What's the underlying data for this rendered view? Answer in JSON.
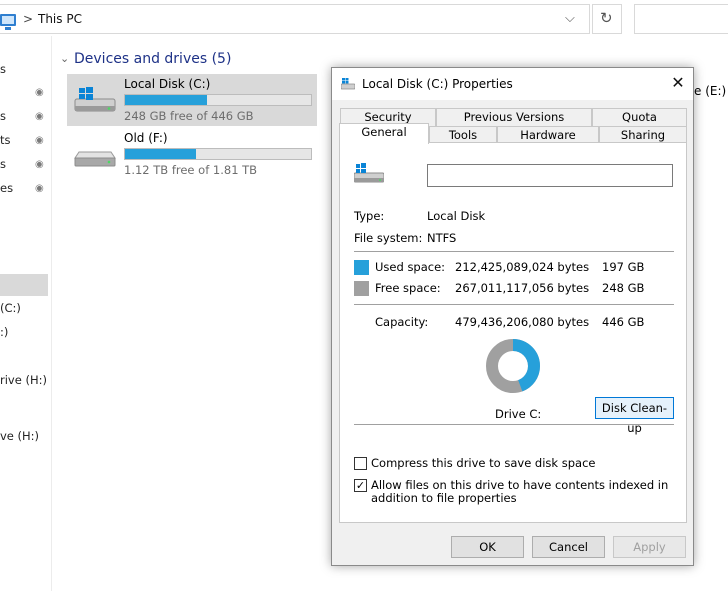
{
  "explorer": {
    "breadcrumb": {
      "separator": ">",
      "location": "This PC"
    },
    "address_dropdown_glyph": "⌵",
    "refresh_glyph": "↻",
    "nav_items": [
      {
        "label": "s"
      },
      {
        "label": "s"
      },
      {
        "label": "ts"
      },
      {
        "label": "s"
      },
      {
        "label": "es"
      },
      {
        "label": "(C:)"
      },
      {
        "label": ":)"
      },
      {
        "label": "rive (H:)"
      },
      {
        "label": "ve (H:)"
      }
    ],
    "pin_glyph": "📌",
    "group": {
      "chevron": "⌄",
      "title": "Devices and drives (5)"
    },
    "drives": [
      {
        "name": "Local Disk (C:)",
        "free_text": "248 GB free of 446 GB",
        "used_fraction": 0.44
      },
      {
        "name": "Old (F:)",
        "free_text": "1.12 TB free of 1.81 TB",
        "used_fraction": 0.38
      }
    ],
    "partial_drive_label": "e (E:)"
  },
  "dialog": {
    "title": "Local Disk (C:) Properties",
    "close_glyph": "✕",
    "tabs_row1": [
      "Security",
      "Previous Versions",
      "Quota"
    ],
    "tabs_row2": [
      "General",
      "Tools",
      "Hardware",
      "Sharing"
    ],
    "active_tab": "General",
    "name_value": "",
    "type_label": "Type:",
    "type_value": "Local Disk",
    "fs_label": "File system:",
    "fs_value": "NTFS",
    "used_label": "Used space:",
    "used_bytes": "212,425,089,024 bytes",
    "used_gb": "197 GB",
    "free_label": "Free space:",
    "free_bytes": "267,011,117,056 bytes",
    "free_gb": "248 GB",
    "capacity_label": "Capacity:",
    "capacity_bytes": "479,436,206,080 bytes",
    "capacity_gb": "446 GB",
    "used_fraction": 0.443,
    "colors": {
      "used": "#26a0da",
      "free": "#a0a0a0"
    },
    "drive_label": "Drive C:",
    "cleanup_button": "Disk Clean-up",
    "compress_label": "Compress this drive to save disk space",
    "compress_checked": "",
    "index_label": "Allow files on this drive to have contents indexed in addition to file properties",
    "index_checked": "✓",
    "ok": "OK",
    "cancel": "Cancel",
    "apply": "Apply"
  }
}
